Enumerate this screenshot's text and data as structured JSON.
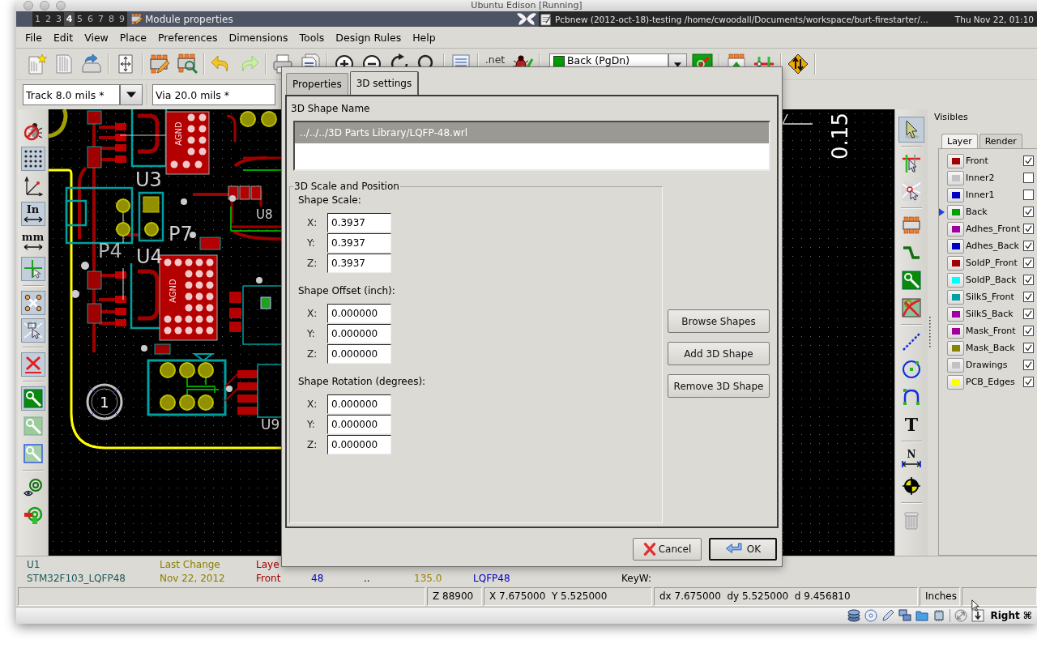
{
  "host_window": {
    "title": "Ubuntu Edison [Running]"
  },
  "top_panel": {
    "workspaces": [
      {
        "label": "1",
        "selected": false
      },
      {
        "label": "2",
        "selected": false
      },
      {
        "label": "3",
        "selected": false
      },
      {
        "label": "4",
        "selected": true
      },
      {
        "label": "5",
        "selected": false
      },
      {
        "label": "6",
        "selected": false
      },
      {
        "label": "7",
        "selected": false
      },
      {
        "label": "8",
        "selected": false
      },
      {
        "label": "9",
        "selected": false
      }
    ],
    "focused_window": "Module properties",
    "app_title": "Pcbnew (2012-oct-18)-testing /home/cwoodall/Documents/workspace/burt-firestarter/...",
    "clock": "Thu Nov 22, 01:10"
  },
  "menu_bar": [
    "File",
    "Edit",
    "View",
    "Place",
    "Preferences",
    "Dimensions",
    "Tools",
    "Design Rules",
    "Help"
  ],
  "main_toolbar": {
    "netlist_label": ".net",
    "layer": {
      "label": "Back (PgDn)",
      "color": "#00a000"
    }
  },
  "options_toolbar": {
    "track": "Track 8.0 mils *",
    "via": "Via 20.0 mils *"
  },
  "left_toolbar": [
    [
      {
        "kind": "drc",
        "on": false
      },
      {
        "kind": "grid",
        "on": true
      },
      {
        "kind": "polar",
        "on": false
      },
      {
        "kind": "units",
        "label": "In",
        "on": true
      },
      {
        "kind": "units",
        "label": "mm",
        "on": false
      },
      {
        "kind": "cursor",
        "on": true
      }
    ],
    [
      {
        "kind": "ratsnest",
        "on": true
      },
      {
        "kind": "module_ratsnest",
        "on": true
      }
    ],
    [
      {
        "kind": "auto_delete",
        "on": true
      }
    ],
    [
      {
        "kind": "zone_filled",
        "on": true
      },
      {
        "kind": "zone_sketch",
        "on": false
      },
      {
        "kind": "zone_outline",
        "on": false
      }
    ],
    [
      {
        "kind": "high_contrast",
        "on": false
      },
      {
        "kind": "via",
        "on": false
      }
    ]
  ],
  "right_toolbar": [
    [
      {
        "kind": "select",
        "on": true
      }
    ],
    [
      {
        "kind": "highlight_net",
        "on": false
      },
      {
        "kind": "local_ratsnest",
        "on": false
      }
    ],
    [
      {
        "kind": "module",
        "on": false
      },
      {
        "kind": "track",
        "on": false
      },
      {
        "kind": "zone",
        "on": false
      },
      {
        "kind": "keepout",
        "on": false
      }
    ],
    [
      {
        "kind": "line",
        "on": false
      },
      {
        "kind": "circle",
        "on": false
      },
      {
        "kind": "arc",
        "on": false
      },
      {
        "kind": "text",
        "label": "T",
        "on": false
      }
    ],
    [
      {
        "kind": "dimension",
        "label": "N",
        "on": false
      },
      {
        "kind": "target",
        "on": false
      }
    ],
    [
      {
        "kind": "delete",
        "on": false
      }
    ]
  ],
  "canvas": {
    "labels": [
      "U3",
      "P7",
      "P4",
      "U4",
      "U8",
      "U9",
      "1",
      "AGND",
      "AGND",
      "0.15"
    ]
  },
  "layers_panel": {
    "title": "Visibles",
    "tabs": [
      {
        "label": "Layer",
        "selected": true
      },
      {
        "label": "Render",
        "selected": false
      }
    ],
    "layers": [
      {
        "name": "Front",
        "color": "#a00000",
        "checked": true,
        "selected": false
      },
      {
        "name": "Inner2",
        "color": "#c2c2c2",
        "checked": false,
        "selected": false
      },
      {
        "name": "Inner1",
        "color": "#0000c2",
        "checked": false,
        "selected": false
      },
      {
        "name": "Back",
        "color": "#00a000",
        "checked": true,
        "selected": true
      },
      {
        "name": "Adhes_Front",
        "color": "#a000a0",
        "checked": true,
        "selected": false
      },
      {
        "name": "Adhes_Back",
        "color": "#0000c2",
        "checked": true,
        "selected": false
      },
      {
        "name": "SoldP_Front",
        "color": "#a00000",
        "checked": true,
        "selected": false
      },
      {
        "name": "SoldP_Back",
        "color": "#00ffff",
        "checked": true,
        "selected": false
      },
      {
        "name": "SilkS_Front",
        "color": "#00a0a0",
        "checked": true,
        "selected": false
      },
      {
        "name": "SilkS_Back",
        "color": "#a000a0",
        "checked": true,
        "selected": false
      },
      {
        "name": "Mask_Front",
        "color": "#a000a0",
        "checked": true,
        "selected": false
      },
      {
        "name": "Mask_Back",
        "color": "#848400",
        "checked": true,
        "selected": false
      },
      {
        "name": "Drawings",
        "color": "#c2c2c2",
        "checked": true,
        "selected": false
      },
      {
        "name": "PCB_Edges",
        "color": "#ffff00",
        "checked": true,
        "selected": false
      }
    ]
  },
  "message_panel": [
    {
      "label": "U1",
      "value": "STM32F103_LQFP48",
      "color": "#1e5a5a"
    },
    {
      "label": "Last Change",
      "value": "Nov 22, 2012",
      "color": "#8a8000"
    },
    {
      "label": "Laye",
      "value": "Front",
      "color": "#a00000"
    },
    {
      "value": "48",
      "color": "#0000c0"
    },
    {
      "value": ".."
    },
    {
      "value": "135.0",
      "color": "#a08000"
    },
    {
      "value": "LQFP48",
      "color": "#0000c0"
    },
    {
      "value": "KeyW:",
      "color": "#000000"
    }
  ],
  "status_bar": [
    "Z 88900",
    "X 7.675000  Y 5.525000",
    "dx 7.675000  dy 5.525000  d 9.456810",
    "Inches"
  ],
  "vm_status": {
    "host_key": "Right ⌘"
  },
  "dialog": {
    "tabs": [
      {
        "label": "Properties",
        "selected": false
      },
      {
        "label": "3D settings",
        "selected": true
      }
    ],
    "shape_name_title": "3D Shape Name",
    "shapes": [
      {
        "path": "../../../3D Parts Library/LQFP-48.wrl",
        "selected": true
      }
    ],
    "group_title": "3D Scale and Position",
    "sections": [
      {
        "title": "Shape Scale:",
        "fields": [
          {
            "axis": "X:",
            "value": "0.3937"
          },
          {
            "axis": "Y:",
            "value": "0.3937"
          },
          {
            "axis": "Z:",
            "value": "0.3937"
          }
        ]
      },
      {
        "title": "Shape Offset (inch):",
        "fields": [
          {
            "axis": "X:",
            "value": "0.000000"
          },
          {
            "axis": "Y:",
            "value": "0.000000"
          },
          {
            "axis": "Z:",
            "value": "0.000000"
          }
        ]
      },
      {
        "title": "Shape Rotation (degrees):",
        "fields": [
          {
            "axis": "X:",
            "value": "0.000000"
          },
          {
            "axis": "Y:",
            "value": "0.000000"
          },
          {
            "axis": "Z:",
            "value": "0.000000"
          }
        ]
      }
    ],
    "side_buttons": [
      "Browse Shapes",
      "Add 3D Shape",
      "Remove 3D Shape"
    ],
    "cancel": "Cancel",
    "ok": "OK"
  }
}
